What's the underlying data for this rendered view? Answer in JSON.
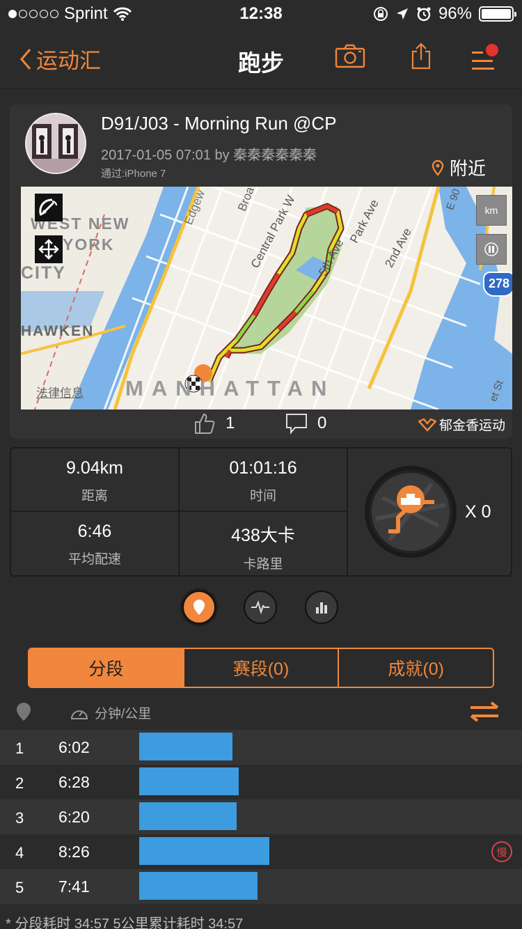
{
  "status_bar": {
    "carrier": "Sprint",
    "time": "12:38",
    "battery": "96%",
    "signal_bars_filled": 1
  },
  "nav": {
    "back_label": "运动汇",
    "title": "跑步"
  },
  "activity": {
    "title": "D91/J03 - Morning Run @CP",
    "meta": "2017-01-05 07:01 by 秦秦秦秦秦秦",
    "device": "通过:iPhone 7",
    "nearby": "附近"
  },
  "map": {
    "labels": {
      "west_new": "WEST NEW",
      "york": "YORK",
      "city": "CITY",
      "hawken": "HAWKEN",
      "manhattan": "MANHATTAN",
      "edgewater": "Edgew",
      "broadway": "Broa",
      "central_park_w": "Central Park W",
      "fifth_ave": "5th Ave",
      "park_ave": "Park Ave",
      "second_ave": "2nd Ave",
      "e90": "E 90",
      "st": "et St",
      "highway": "278"
    },
    "legal": "法律信息",
    "km_label": "km"
  },
  "social": {
    "likes": "1",
    "comments": "0",
    "brand": "郁金香运动"
  },
  "stats": {
    "distance": {
      "value": "9.04km",
      "label": "距离"
    },
    "time": {
      "value": "01:01:16",
      "label": "时间"
    },
    "pace": {
      "value": "6:46",
      "label": "平均配速"
    },
    "calories": {
      "value": "438大卡",
      "label": "卡路里"
    },
    "badge_count": "X 0"
  },
  "tabs": [
    {
      "label": "分段",
      "active": true
    },
    {
      "label": "赛段(0)",
      "active": false
    },
    {
      "label": "成就(0)",
      "active": false
    }
  ],
  "splits": {
    "unit_label": "分钟/公里",
    "rows": [
      {
        "index": "1",
        "pace": "6:02",
        "pace_seconds": 362,
        "slow": false
      },
      {
        "index": "2",
        "pace": "6:28",
        "pace_seconds": 388,
        "slow": false
      },
      {
        "index": "3",
        "pace": "6:20",
        "pace_seconds": 380,
        "slow": false
      },
      {
        "index": "4",
        "pace": "8:26",
        "pace_seconds": 506,
        "slow": true
      },
      {
        "index": "5",
        "pace": "7:41",
        "pace_seconds": 461,
        "slow": false
      }
    ],
    "slow_label": "慢",
    "footer": "* 分段耗时 34:57   5公里累计耗时 34:57"
  },
  "colors": {
    "accent": "#f0873c",
    "bar": "#3d9be0",
    "background": "#2b2b2b",
    "slow": "#d54545"
  }
}
